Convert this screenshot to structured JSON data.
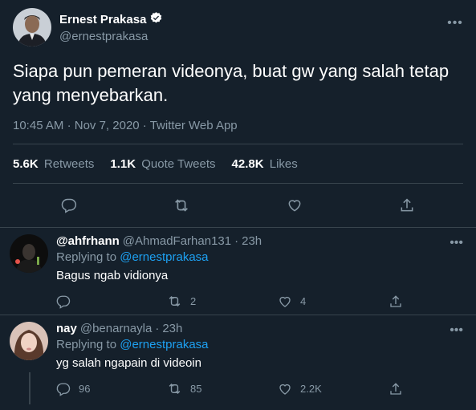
{
  "tweet": {
    "display_name": "Ernest Prakasa",
    "handle": "@ernestprakasa",
    "verified": true,
    "text": "Siapa pun pemeran videonya, buat gw yang salah tetap yang menyebarkan.",
    "time": "10:45 AM",
    "date": "Nov 7, 2020",
    "separator": "·",
    "source": "Twitter Web App",
    "stats": [
      {
        "num": "5.6K",
        "label": "Retweets"
      },
      {
        "num": "1.1K",
        "label": "Quote Tweets"
      },
      {
        "num": "42.8K",
        "label": "Likes"
      }
    ],
    "more_icon": "•••"
  },
  "replies": [
    {
      "display_name": "@ahfrhann",
      "handle": "@AhmadFarhan131",
      "time": "23h",
      "replying_prefix": "Replying to",
      "replying_to": "@ernestprakasa",
      "text": "Bagus ngab vidionya",
      "reply_count": "",
      "retweet_count": "2",
      "like_count": "4"
    },
    {
      "display_name": "nay",
      "handle": "@benarnayla",
      "time": "23h",
      "replying_prefix": "Replying to",
      "replying_to": "@ernestprakasa",
      "text": "yg salah ngapain di videoin",
      "reply_count": "96",
      "retweet_count": "85",
      "like_count": "2.2K"
    }
  ],
  "colors": {
    "background": "#15202b",
    "secondary_text": "#8899a6",
    "link": "#1da1f2",
    "border": "#38444d"
  }
}
